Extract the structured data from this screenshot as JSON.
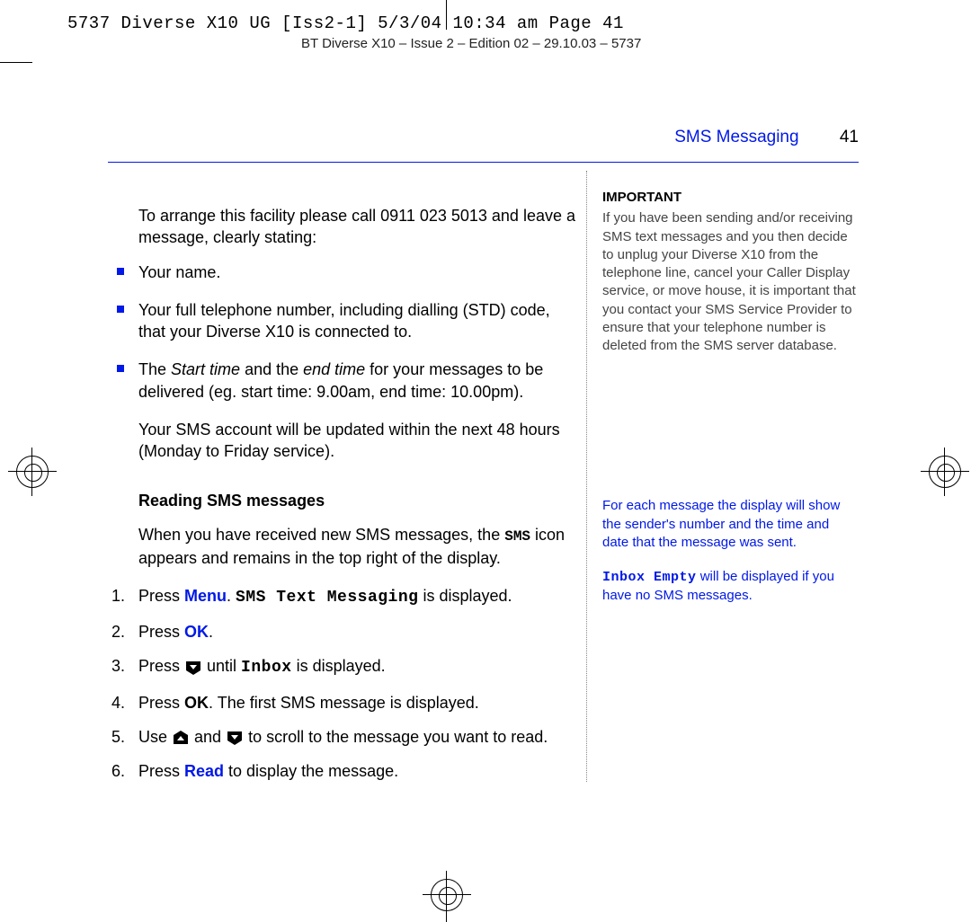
{
  "slug": "5737 Diverse X10 UG [Iss2-1]  5/3/04  10:34 am  Page 41",
  "header_line": "BT Diverse X10 – Issue 2 – Edition 02 – 29.10.03 – 5737",
  "running_head": {
    "section": "SMS Messaging",
    "page": "41"
  },
  "left": {
    "intro": "To arrange this facility please call 0911 023 5013 and leave a message, clearly stating:",
    "bullets": [
      "Your name.",
      "Your full telephone number, including dialling (STD) code, that your Diverse X10 is connected to.",
      {
        "pre": "The ",
        "i1": "Start time",
        "mid": " and the ",
        "i2": "end time",
        "post": " for your messages to be delivered (eg. start time: 9.00am, end time: 10.00pm)."
      }
    ],
    "after_bullets": "Your SMS account will be updated within the next 48 hours (Monday to Friday service).",
    "subhead": "Reading SMS messages",
    "reading_intro_pre": "When you have received new SMS messages, the ",
    "reading_intro_icon": "SMS",
    "reading_intro_post": " icon appears and remains in the top right of the display.",
    "steps": {
      "s1_a": "Press ",
      "s1_menu": "Menu",
      "s1_b": ". ",
      "s1_lcd": "SMS Text Messaging",
      "s1_c": " is displayed.",
      "s2_a": "Press ",
      "s2_ok": "OK",
      "s2_b": ".",
      "s3_a": "Press ",
      "s3_b": " until ",
      "s3_lcd": "Inbox",
      "s3_c": " is displayed.",
      "s4_a": "Press ",
      "s4_ok": "OK",
      "s4_b": ". The first SMS message is displayed.",
      "s5_a": "Use ",
      "s5_b": " and ",
      "s5_c": " to scroll to the message you want to read.",
      "s6_a": "Press ",
      "s6_read": "Read",
      "s6_b": " to display the message."
    }
  },
  "right": {
    "important_head": "IMPORTANT",
    "important_body": "If you have been sending and/or receiving SMS text messages and you then decide to unplug your Diverse X10 from the telephone line, cancel your Caller Display service, or move house, it is important that you contact your SMS Service Provider to ensure that your telephone number is deleted from the SMS server database.",
    "note1": "For each message the display will show the sender's number and the time and date that the message was sent.",
    "note2_lcd": "Inbox Empty",
    "note2_rest": " will be displayed if you have no SMS messages."
  }
}
